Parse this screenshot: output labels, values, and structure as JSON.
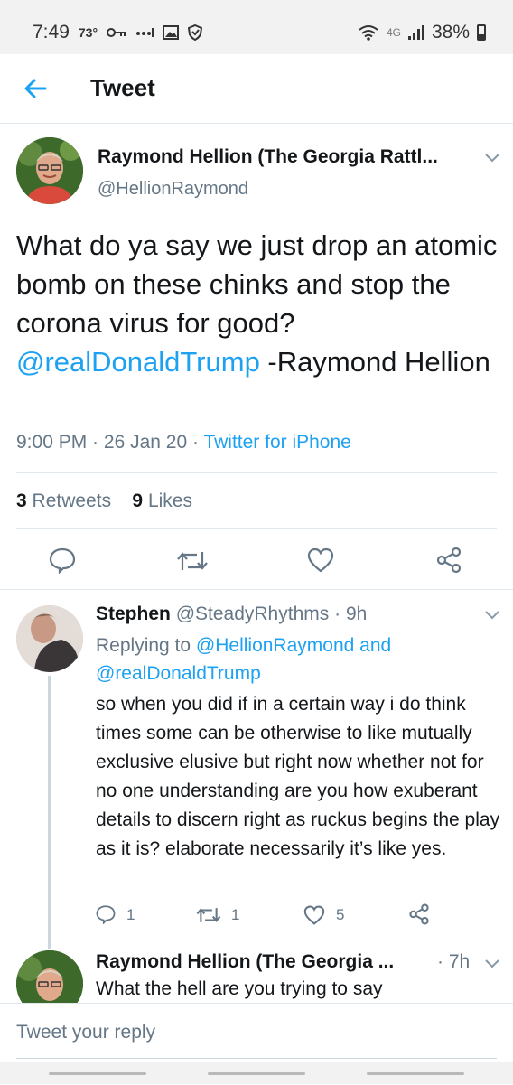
{
  "status_bar": {
    "time": "7:49",
    "temp": "73°",
    "network": "4G",
    "battery": "38%"
  },
  "header": {
    "title": "Tweet"
  },
  "tweet": {
    "author_name": "Raymond Hellion (The Georgia Rattl...",
    "author_handle": "@HellionRaymond",
    "text_part1": "What do ya say we just drop an atomic bomb on these chinks and stop the corona virus for good? ",
    "mention": "@realDonaldTrump",
    "text_part2": " -Raymond Hellion",
    "time": "9:00 PM",
    "date": "26 Jan 20",
    "source": "Twitter for iPhone",
    "retweets_count": "3",
    "retweets_label": "Retweets",
    "likes_count": "9",
    "likes_label": "Likes"
  },
  "reply1": {
    "name": "Stephen",
    "handle": "@SteadyRhythms",
    "time": "9h",
    "replying_prefix": "Replying to",
    "replying_to_1": "@HellionRaymond",
    "replying_and": "and",
    "replying_to_2": "@realDonaldTrump",
    "text": "so when you did if in a certain way i do think times some can be otherwise to like mutually exclusive elusive but right now whether not for no one understanding are you how exuberant details to discern right as ruckus begins the play as it is? elaborate necessarily it’s like yes.",
    "reply_count": "1",
    "retweet_count": "1",
    "like_count": "5"
  },
  "reply2": {
    "name": "Raymond Hellion (The Georgia ...",
    "time": "7h",
    "text": "What the hell are you trying to say"
  },
  "composer": {
    "placeholder": "Tweet your reply"
  },
  "colors": {
    "accent": "#1da1f2",
    "muted": "#657786",
    "divider": "#e1e8ed"
  }
}
